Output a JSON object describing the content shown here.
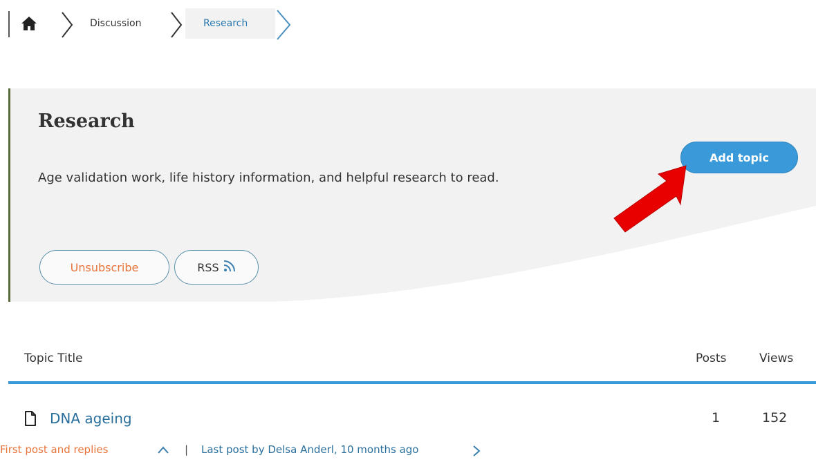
{
  "breadcrumb": {
    "home_icon": "home-icon",
    "items": [
      {
        "label": "Discussion"
      },
      {
        "label": "Research"
      }
    ]
  },
  "header": {
    "title": "Research",
    "description": "Age validation work, life history information, and helpful research to read.",
    "add_topic_label": "Add topic",
    "unsubscribe_label": "Unsubscribe",
    "rss_label": "RSS",
    "accent_color": "#3a9ad9",
    "border_color": "#5a6b3a"
  },
  "table": {
    "columns": {
      "title": "Topic Title",
      "posts": "Posts",
      "views": "Views"
    },
    "rows": [
      {
        "icon": "document-icon",
        "title": "DNA ageing",
        "posts": "1",
        "views": "152",
        "first_post_label": "First post and replies",
        "separator": "|",
        "last_post_label": "Last post by Delsa Anderl, 10 months ago"
      }
    ]
  },
  "annotation": {
    "arrow_color": "#e80000"
  }
}
